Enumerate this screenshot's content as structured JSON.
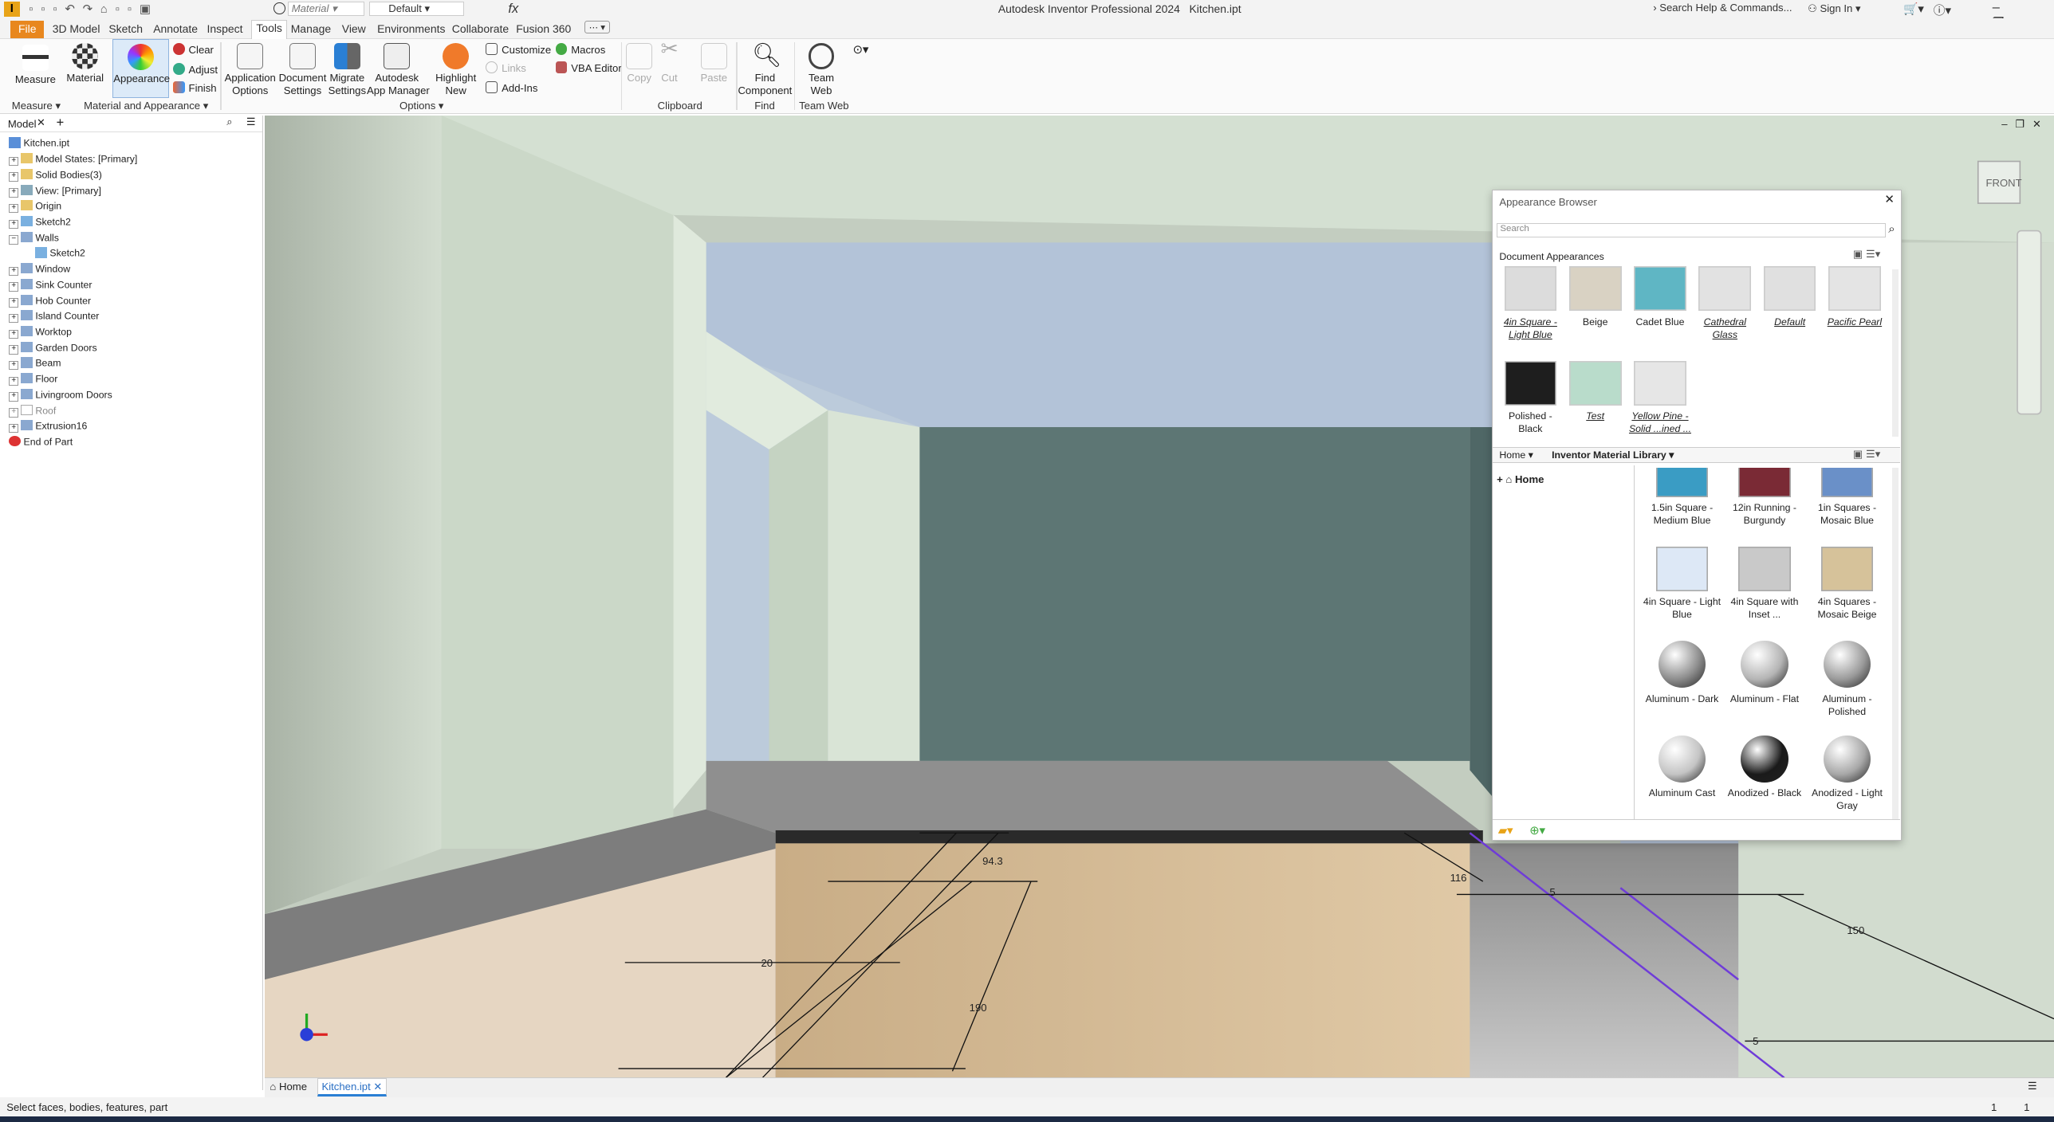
{
  "app": {
    "title": "Autodesk Inventor Professional 2024",
    "file": "Kitchen.ipt",
    "search_placeholder": "Search Help & Commands...",
    "sign_in": "Sign In",
    "qat_material": "Material",
    "qat_default": "Default"
  },
  "tabs": [
    "File",
    "3D Model",
    "Sketch",
    "Annotate",
    "Inspect",
    "Tools",
    "Manage",
    "View",
    "Environments",
    "Collaborate",
    "Fusion 360"
  ],
  "ribbon": {
    "measure": "Measure",
    "material": "Material",
    "appearance": "Appearance",
    "clear": "Clear",
    "adjust": "Adjust",
    "finish": "Finish",
    "app_options": "Application\nOptions",
    "doc_settings": "Document\nSettings",
    "migrate": "Migrate\nSettings",
    "app_manager": "Autodesk\nApp Manager",
    "highlight": "Highlight\nNew",
    "customize": "Customize",
    "macros": "Macros",
    "links": "Links",
    "vba": "VBA Editor",
    "addins": "Add-Ins",
    "copy": "Copy",
    "cut": "Cut",
    "paste": "Paste",
    "find": "Find\nComponent",
    "team_web": "Team Web",
    "groups": {
      "measure": "Measure ▾",
      "mat": "Material and Appearance ▾",
      "options": "Options ▾",
      "clipboard": "Clipboard",
      "find": "Find",
      "teamweb": "Team Web"
    }
  },
  "browser": {
    "tab": "Model",
    "items": [
      "Kitchen.ipt",
      "Model States: [Primary]",
      "Solid Bodies(3)",
      "View: [Primary]",
      "Origin",
      "Sketch2",
      "Walls",
      "Sketch2",
      "Window",
      "Sink Counter",
      "Hob Counter",
      "Island Counter",
      "Worktop",
      "Garden Doors",
      "Beam",
      "Floor",
      "Livingroom Doors",
      "Roof",
      "Extrusion16",
      "End of Part"
    ]
  },
  "appearance_browser": {
    "title": "Appearance Browser",
    "search_placeholder": "Search",
    "doc_section": "Document Appearances",
    "doc_items": [
      {
        "label": "4in Square - Light Blue",
        "color": "#dcdcdc",
        "italic": true
      },
      {
        "label": "Beige",
        "color": "#d9d2c3",
        "italic": false
      },
      {
        "label": "Cadet Blue",
        "color": "#5fb6c4",
        "italic": false
      },
      {
        "label": "Cathedral Glass",
        "color": "#e2e2e2",
        "italic": true
      },
      {
        "label": "Default",
        "color": "#e0e0e0",
        "italic": true
      },
      {
        "label": "Pacific Pearl",
        "color": "#e4e4e4",
        "italic": true
      },
      {
        "label": "Polished - Black",
        "color": "#1e1e1e",
        "italic": false
      },
      {
        "label": "Test",
        "color": "#b9dccb",
        "italic": true
      },
      {
        "label": "Yellow Pine - Solid ...ined ...",
        "color": "#e6e6e6",
        "italic": true
      }
    ],
    "home_label": "Home",
    "library": "Inventor Material Library",
    "tree_home": "Home",
    "lib_items": [
      {
        "label": "1.5in Square - Medium Blue",
        "color": "#3a9cc4"
      },
      {
        "label": "12in Running - Burgundy",
        "color": "#7a2a35"
      },
      {
        "label": "1in Squares - Mosaic Blue",
        "color": "#6a90c8"
      },
      {
        "label": "4in Square - Light Blue",
        "color": "#dde8f6"
      },
      {
        "label": "4in Square with Inset ...",
        "color": "#c9c9c9"
      },
      {
        "label": "4in Squares - Mosaic Beige",
        "color": "#d6c29a"
      },
      {
        "label": "Aluminum - Dark",
        "color": "#8d8d8d"
      },
      {
        "label": "Aluminum - Flat",
        "color": "#b4b4b4"
      },
      {
        "label": "Aluminum - Polished",
        "color": "#9a9a9a"
      },
      {
        "label": "Aluminum Cast",
        "color": "#c4c4c4"
      },
      {
        "label": "Anodized - Black",
        "color": "#1a1a1a"
      },
      {
        "label": "Anodized - Light Gray",
        "color": "#a8a8a8"
      }
    ]
  },
  "viewcube": "FRONT",
  "dimensions": {
    "d1": "94.3",
    "d2": "116",
    "d3": "20",
    "d4": "190",
    "d5": "150",
    "d6": "5",
    "d7": "5"
  },
  "doc_tabs": {
    "home": "Home",
    "file": "Kitchen.ipt"
  },
  "status": {
    "text": "Select faces, bodies, features, part",
    "n1": "1",
    "n2": "1"
  }
}
